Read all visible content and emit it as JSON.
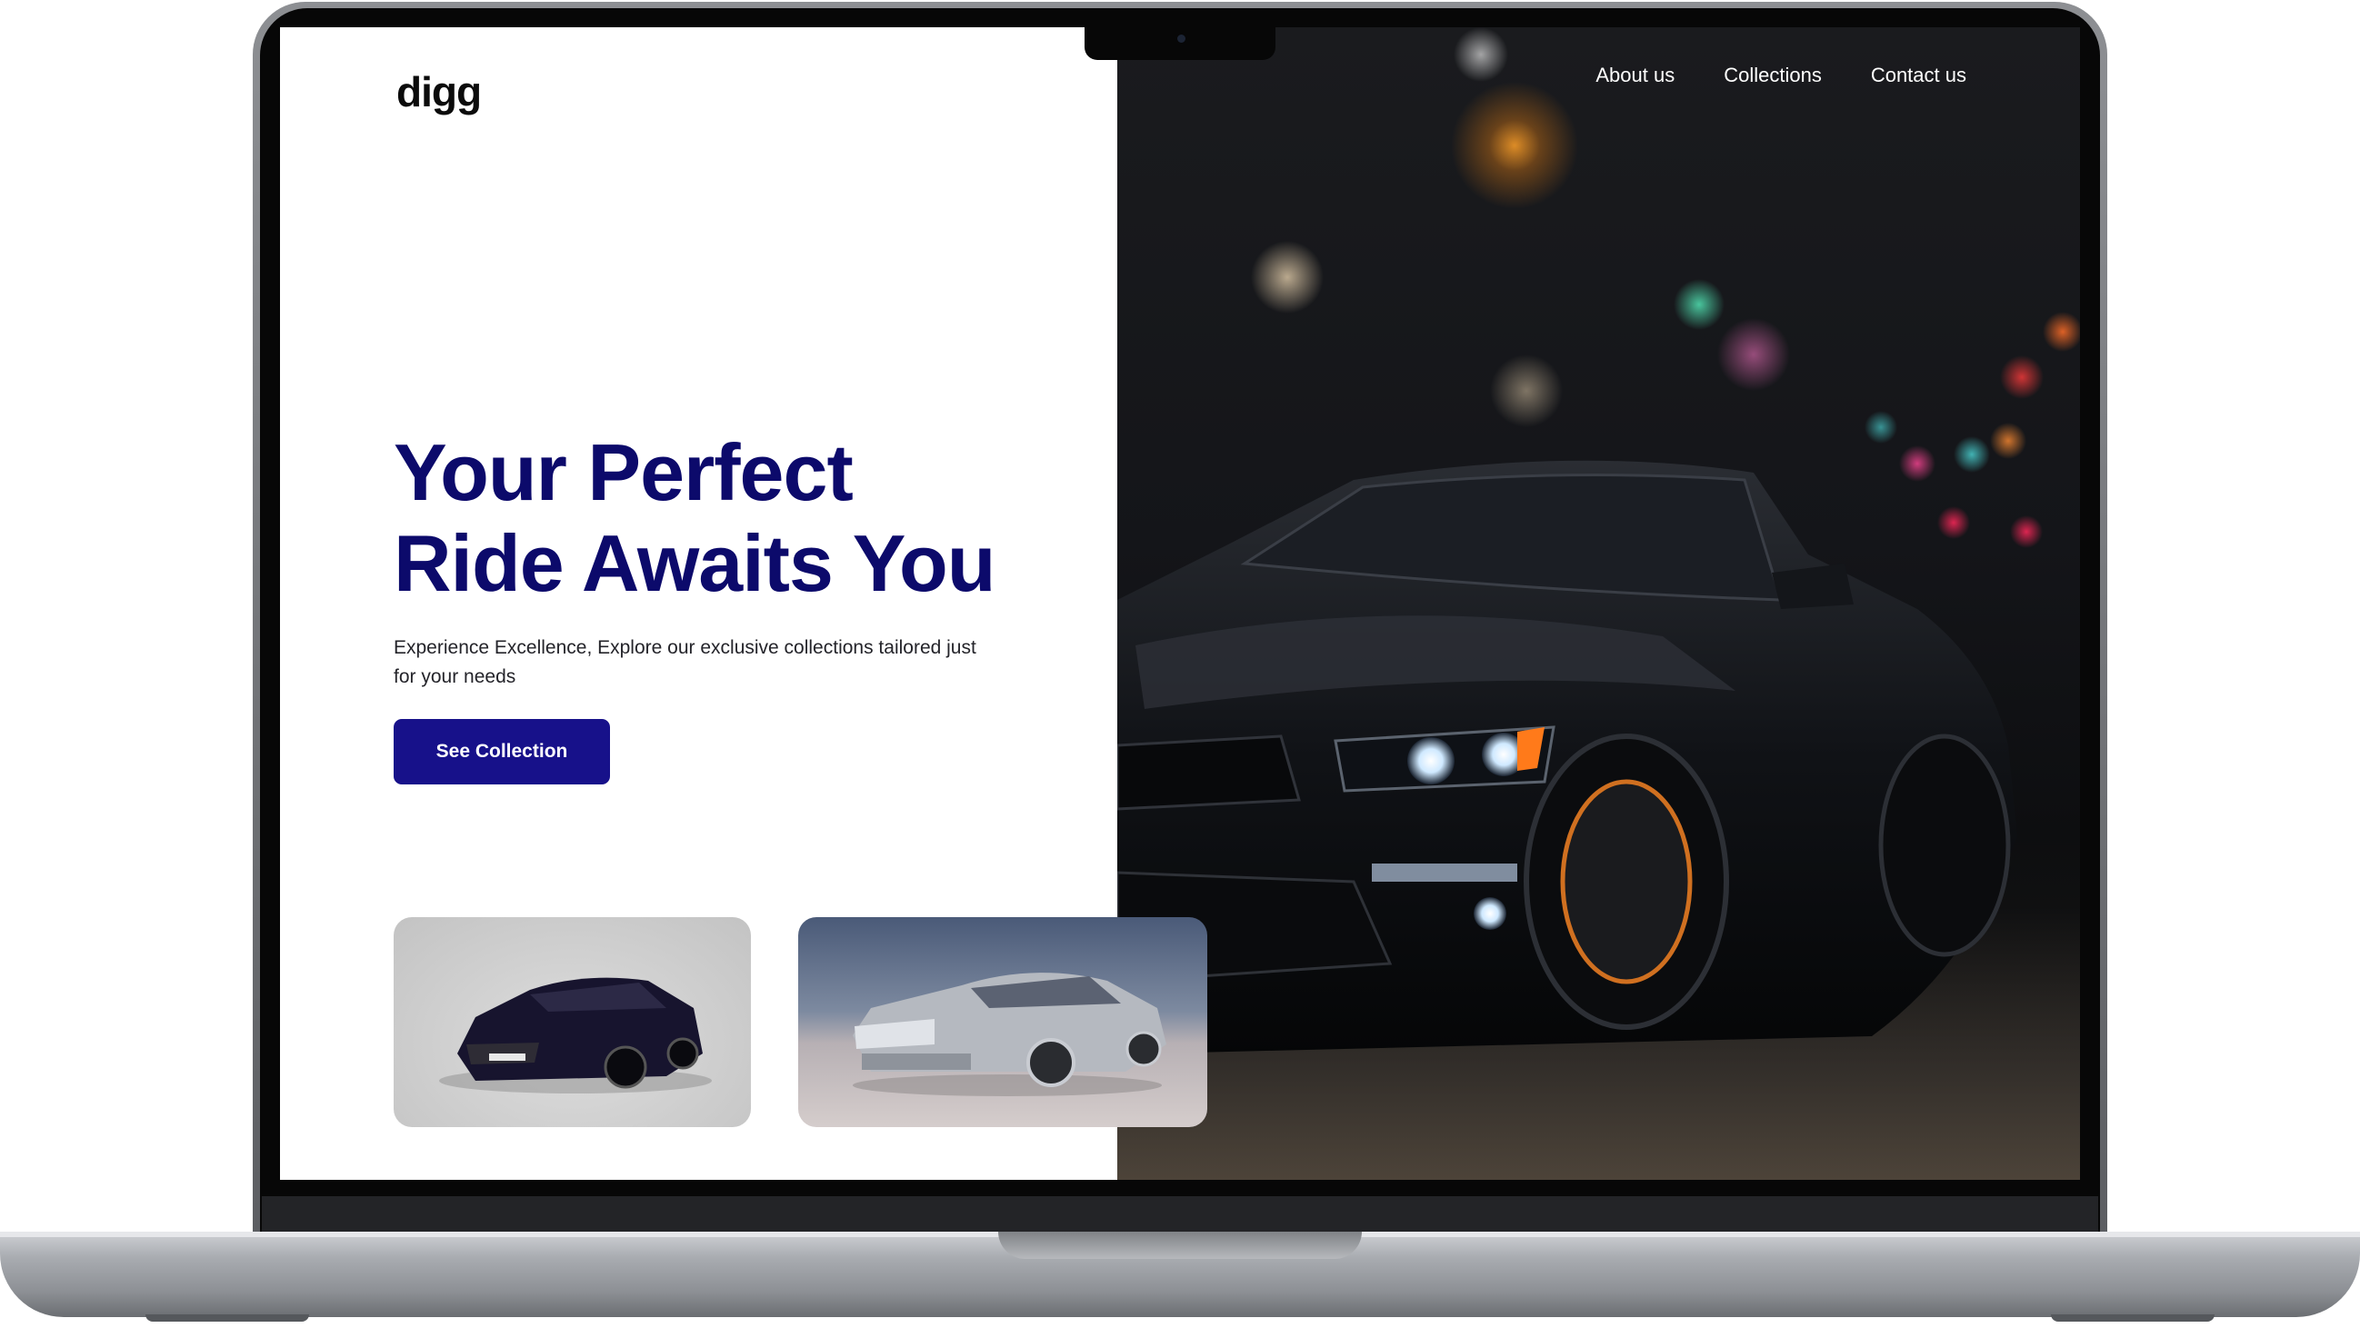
{
  "site": {
    "logo": "digg",
    "nav": [
      {
        "label": "About us"
      },
      {
        "label": "Collections"
      },
      {
        "label": "Contact us"
      }
    ]
  },
  "hero": {
    "headline": "Your Perfect\nRide Awaits You",
    "subtext": "Experience Excellence, Explore our exclusive collections tailored just for your needs",
    "cta_label": "See Collection"
  },
  "colors": {
    "headline": "#0c0a6b",
    "cta_background": "#17118a",
    "page_background": "#ffffff"
  }
}
